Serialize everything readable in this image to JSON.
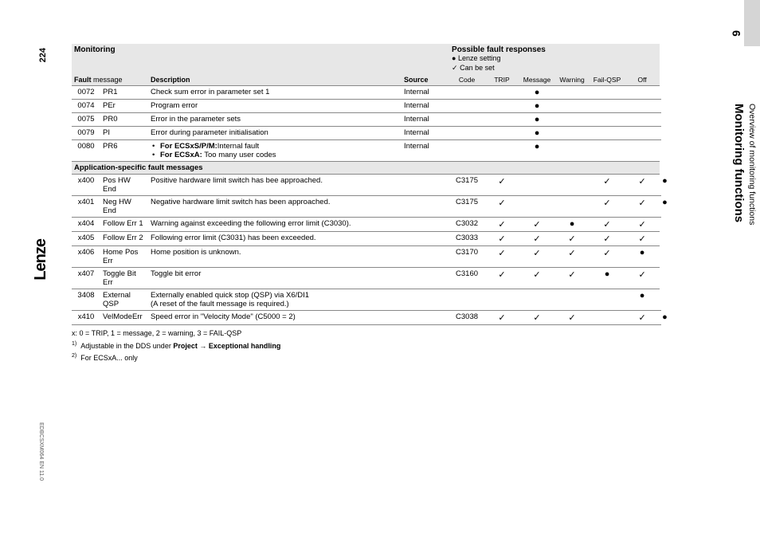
{
  "sidebar": {
    "chapter_num": "9",
    "title": "Monitoring functions",
    "subtitle": "Overview of monitoring functions"
  },
  "left": {
    "page_num": "224",
    "logo": "Lenze",
    "doc_id": "EDBCSXM064 EN 11.0"
  },
  "table": {
    "hdr_monitoring": "Monitoring",
    "hdr_responses": "Possible fault responses",
    "hdr_lenze": "Lenze setting",
    "hdr_canset": "Can be set",
    "col_fault": "Fault",
    "col_message": "message",
    "col_description": "Description",
    "col_source": "Source",
    "cols": [
      "Code",
      "TRIP",
      "Message",
      "Warning",
      "Fail-QSP",
      "Off"
    ],
    "rows_part1": [
      {
        "fault": "0072",
        "msg": "PR1",
        "desc": "Check sum error in parameter set 1",
        "src": "Internal",
        "code": "",
        "marks": [
          "",
          "●",
          "",
          "",
          "",
          ""
        ]
      },
      {
        "fault": "0074",
        "msg": "PEr",
        "desc": "Program error",
        "src": "Internal",
        "code": "",
        "marks": [
          "",
          "●",
          "",
          "",
          "",
          ""
        ]
      },
      {
        "fault": "0075",
        "msg": "PR0",
        "desc": "Error in the parameter sets",
        "src": "Internal",
        "code": "",
        "marks": [
          "",
          "●",
          "",
          "",
          "",
          ""
        ]
      },
      {
        "fault": "0079",
        "msg": "PI",
        "desc": "Error during parameter initialisation",
        "src": "Internal",
        "code": "",
        "marks": [
          "",
          "●",
          "",
          "",
          "",
          ""
        ]
      }
    ],
    "row_pr6": {
      "fault": "0080",
      "msg": "PR6",
      "desc_b1_label": "For ECSxS/P/M:",
      "desc_b1_text": "Internal fault",
      "desc_b2_label": "For ECSxA:",
      "desc_b2_text": " Too many user codes",
      "src": "Internal",
      "code": "",
      "marks": [
        "",
        "●",
        "",
        "",
        "",
        ""
      ]
    },
    "section_title": "Application-specific fault messages",
    "rows_part2": [
      {
        "fault": "x400",
        "msg": "Pos HW End",
        "desc": "Positive hardware limit switch has bee approached.",
        "src": "",
        "code": "C3175",
        "marks": [
          "✓",
          "",
          "",
          "✓",
          "✓",
          "●"
        ]
      },
      {
        "fault": "x401",
        "msg": "Neg HW End",
        "desc": "Negative hardware limit switch has been approached.",
        "src": "",
        "code": "C3175",
        "marks": [
          "✓",
          "",
          "",
          "✓",
          "✓",
          "●"
        ]
      },
      {
        "fault": "x404",
        "msg": "Follow Err 1",
        "desc": "Warning against exceeding the following error limit (C3030).",
        "src": "",
        "code": "C3032",
        "marks": [
          "✓",
          "✓",
          "●",
          "✓",
          "✓"
        ]
      },
      {
        "fault": "x405",
        "msg": "Follow Err 2",
        "desc": "Following error limit (C3031) has been exceeded.",
        "src": "",
        "code": "C3033",
        "marks": [
          "✓",
          "✓",
          "✓",
          "✓",
          "✓"
        ]
      },
      {
        "fault": "x406",
        "msg": "Home Pos Err",
        "desc": "Home position is unknown.",
        "src": "",
        "code": "C3170",
        "marks": [
          "✓",
          "✓",
          "✓",
          "✓",
          "●"
        ]
      },
      {
        "fault": "x407",
        "msg": "Toggle Bit Err",
        "desc": "Toggle bit error",
        "src": "",
        "code": "C3160",
        "marks": [
          "✓",
          "✓",
          "✓",
          "●",
          "✓"
        ]
      }
    ],
    "row_3408": {
      "fault": "3408",
      "msg": "External QSP",
      "desc_l1": "Externally enabled quick stop (QSP) via X6/DI1",
      "desc_l2": "(A reset of the fault message is required.)",
      "src": "",
      "code": "",
      "marks": [
        "",
        "",
        "",
        "",
        "●",
        ""
      ]
    },
    "row_x410": {
      "fault": "x410",
      "msg": "VelModeErr",
      "desc": "Speed error in \"Velocity Mode\" (C5000 = 2)",
      "src": "",
      "code": "C3038",
      "marks": [
        "✓",
        "✓",
        "✓",
        "",
        "✓",
        "●"
      ]
    },
    "footnotes": {
      "fn_x": "x:  0 = TRIP, 1 = message, 2 = warning, 3 = FAIL-QSP",
      "fn_1_pre": "Adjustable in the DDS under ",
      "fn_1_bold": "Project → Exceptional handling",
      "fn_2": "For ECSxA... only"
    }
  }
}
